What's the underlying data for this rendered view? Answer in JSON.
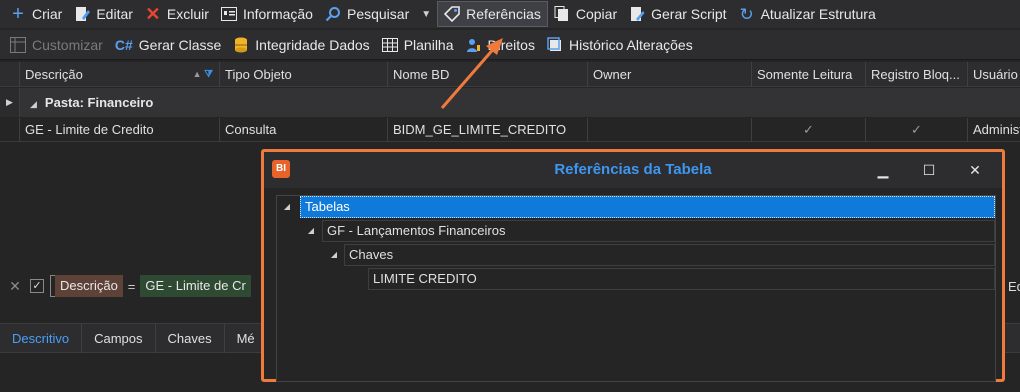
{
  "toolbar1": {
    "criar": "Criar",
    "editar": "Editar",
    "excluir": "Excluir",
    "informacao": "Informação",
    "pesquisar": "Pesquisar",
    "referencias": "Referências",
    "copiar": "Copiar",
    "gerar_script": "Gerar Script",
    "atualizar": "Atualizar Estrutura"
  },
  "toolbar2": {
    "customizar": "Customizar",
    "gerar_classe": "Gerar Classe",
    "integridade": "Integridade Dados",
    "planilha": "Planilha",
    "direitos": "Direitos",
    "historico": "Histórico Alterações"
  },
  "grid": {
    "columns": [
      "Descrição",
      "Tipo Objeto",
      "Nome BD",
      "Owner",
      "Somente Leitura",
      "Registro Bloq...",
      "Usuário"
    ],
    "group_label": "Pasta: Financeiro",
    "row": {
      "descricao": "GE - Limite de Credito",
      "tipo": "Consulta",
      "nome_bd": "BIDM_GE_LIMITE_CREDITO",
      "owner": "",
      "somente_leitura": "✓",
      "registro_bloq": "✓",
      "usuario": "Administ"
    }
  },
  "filter": {
    "field": "Descrição",
    "op": "=",
    "value": "GE - Limite de Cr",
    "right_text": "Ed"
  },
  "tabs": [
    "Descritivo",
    "Campos",
    "Chaves",
    "Mé"
  ],
  "dialog": {
    "logo": "BI",
    "title": "Referências da Tabela",
    "minimize": "▁",
    "maximize": "☐",
    "close": "✕",
    "tree": {
      "root": "Tabelas",
      "child": "GF - Lançamentos Financeiros",
      "grandchild": "Chaves",
      "leaf": "LIMITE CREDITO"
    }
  },
  "colors": {
    "accent": "#3d97f0",
    "highlight_border": "#f07a3c",
    "selection": "#0f7ad9"
  }
}
